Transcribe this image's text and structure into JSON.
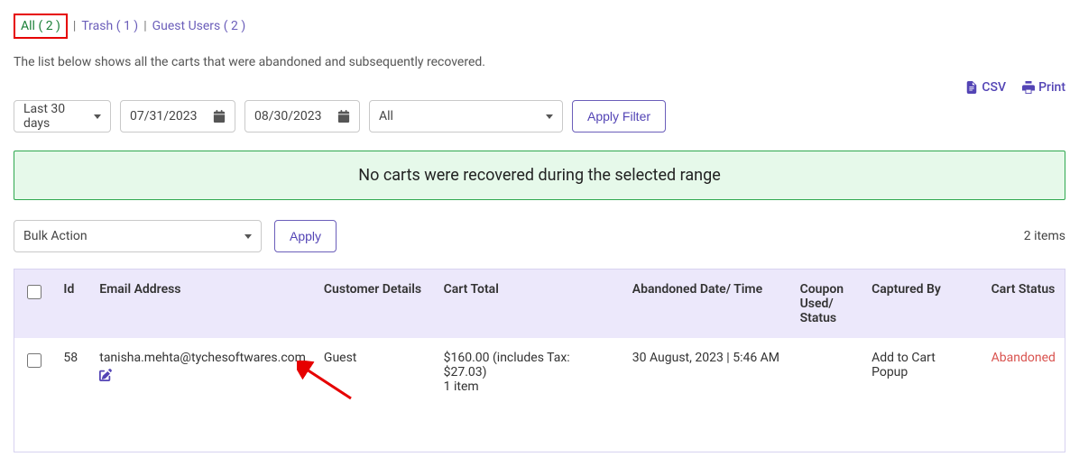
{
  "tabs": {
    "all_label": "All",
    "all_count": "( 2 )",
    "trash_label": "Trash",
    "trash_count": "( 1 )",
    "guest_label": "Guest Users",
    "guest_count": "( 2 )"
  },
  "description": "The list below shows all the carts that were abandoned and subsequently recovered.",
  "export": {
    "csv": "CSV",
    "print": "Print"
  },
  "filters": {
    "range": "Last 30 days",
    "date_from": "07/31/2023",
    "date_to": "08/30/2023",
    "status": "All",
    "apply": "Apply Filter"
  },
  "notice": "No carts were recovered during the selected range",
  "bulk": {
    "label": "Bulk Action",
    "apply": "Apply"
  },
  "item_count": "2 items",
  "columns": {
    "id": "Id",
    "email": "Email Address",
    "custdet": "Customer Details",
    "total": "Cart Total",
    "date": "Abandoned Date/ Time",
    "coupon": "Coupon Used/ Status",
    "captured": "Captured By",
    "status": "Cart Status"
  },
  "rows": [
    {
      "id": "58",
      "email": "tanisha.mehta@tychesoftwares.com",
      "custdet": "Guest",
      "total_line1": "$160.00 (includes Tax: $27.03)",
      "total_line2": "1 item",
      "date": "30 August, 2023 | 5:46 AM",
      "coupon": "",
      "captured": "Add to Cart Popup",
      "status": "Abandoned"
    }
  ]
}
